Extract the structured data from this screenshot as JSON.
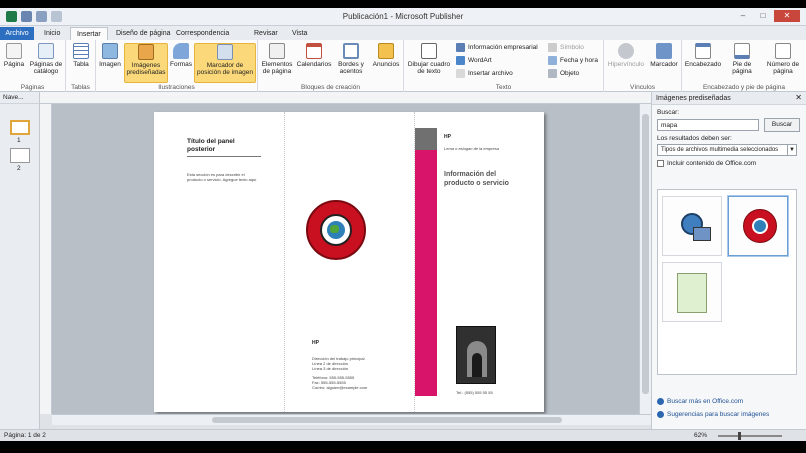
{
  "window": {
    "title": "Publicación1 - Microsoft Publisher"
  },
  "tabs": [
    "Archivo",
    "Inicio",
    "Insertar",
    "Diseño de página",
    "Correspondencia",
    "Revisar",
    "Vista"
  ],
  "ribbon": {
    "paginas": {
      "label": "Páginas",
      "pagina": "Página",
      "paginas_catalogo": "Páginas de catálogo"
    },
    "tablas": {
      "label": "Tablas",
      "tabla": "Tabla"
    },
    "ilustraciones": {
      "label": "Ilustraciones",
      "imagen": "Imagen",
      "imagenes_prediseñadas": "Imágenes prediseñadas",
      "formas": "Formas",
      "marcador": "Marcador de posición de imagen"
    },
    "bloques": {
      "label": "Bloques de creación",
      "elementos": "Elementos de página",
      "calendarios": "Calendarios",
      "bordes": "Bordes y acentos",
      "anuncios": "Anuncios"
    },
    "texto": {
      "label": "Texto",
      "dibujar": "Dibujar cuadro de texto",
      "info_empresarial": "Información empresarial",
      "wordart": "WordArt",
      "insertar_archivo": "Insertar archivo",
      "simbolo": "Símbolo",
      "fecha_hora": "Fecha y hora",
      "objeto": "Objeto"
    },
    "vinculos": {
      "label": "Vínculos",
      "hipervinculo": "Hipervínculo",
      "marcador": "Marcador"
    },
    "encabezado": {
      "label": "Encabezado y pie de página",
      "encabezado": "Encabezado",
      "pie": "Pie de página",
      "numero": "Número de página"
    }
  },
  "nav": {
    "title": "Nave...",
    "pages": [
      "1",
      "2"
    ]
  },
  "document": {
    "panel_title": "Título del panel posterior",
    "panel_body": "Esta sección es para describir el producto o servicio. Agregue texto aquí.",
    "hp_middle": "HP",
    "address": [
      "Dirección del trabajo principal",
      "Línea 2 de dirección",
      "Línea 3 de dirección",
      "",
      "Teléfono: 555-555-5555",
      "Fax: 555-555-5555",
      "Correo: alguien@example.com"
    ],
    "hp_right": "HP",
    "slogan": "Lema o eslogan de la empresa",
    "info_title": "Información del producto o servicio",
    "phone_right": "Tel.: (555) 555 55 55"
  },
  "pane": {
    "title": "Imágenes prediseñadas",
    "buscar_label": "Buscar:",
    "search_value": "mapa",
    "buscar_button": "Buscar",
    "results_label": "Los resultados deben ser:",
    "results_type": "Tipos de archivos multimedia seleccionados",
    "include_office": "Incluir contenido de Office.com",
    "link_more": "Buscar más en Office.com",
    "link_tips": "Sugerencias para buscar imágenes"
  },
  "status": {
    "page": "Página: 1 de 2",
    "zoom": "62%"
  },
  "colors": {
    "accent": "#2c6ebf",
    "pink": "#d7146a",
    "globe_red": "#c81020",
    "highlight": "#fbd97a"
  }
}
